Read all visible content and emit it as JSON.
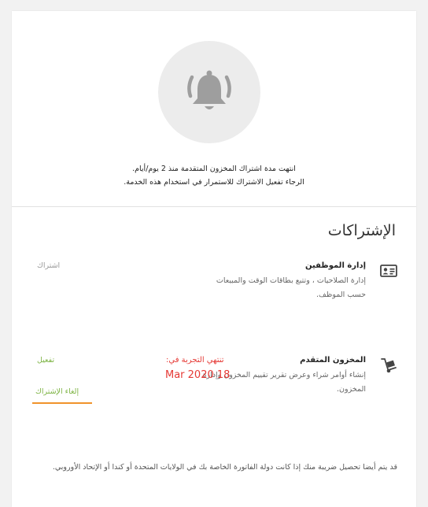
{
  "notice": {
    "line1": "انتهت مدة اشتراك المخزون المتقدمة منذ 2 يوم/أيام.",
    "line2": "الرجاء تفعيل الاشتراك للاستمرار في استخدام هذه الخدمة."
  },
  "subscriptions": {
    "title": "الإشتراكات",
    "items": [
      {
        "name": "إدارة الموظفين",
        "desc": "إدارة الصلاحيات ، وتتبع بطاقات الوقت والمبيعات حسب الموظف.",
        "action": "اشتراك",
        "icon": "id-card-icon"
      },
      {
        "name": "المخزون المتقدم",
        "desc": "إنشاء أوامر شراء وعرض تقرير تقييم المخزون وإدارة المخزون.",
        "trial_label": "تنتهي التجربة في:",
        "trial_date": "Mar 2020 18",
        "activate": "تفعيل",
        "cancel": "إلغاء الإشتراك",
        "icon": "hand-truck-icon"
      }
    ]
  },
  "footnote": "قد يتم أيضا تحصيل ضريبة منك إذا كانت دولة الفاتورة الخاصة بك في الولايات المتحدة أو كندا أو الإتحاد الأوروبي.",
  "colors": {
    "accent_green": "#7cb342",
    "alert_red": "#e53935",
    "underline_orange": "#f0932b",
    "bell_grey": "#9e9e9e"
  }
}
